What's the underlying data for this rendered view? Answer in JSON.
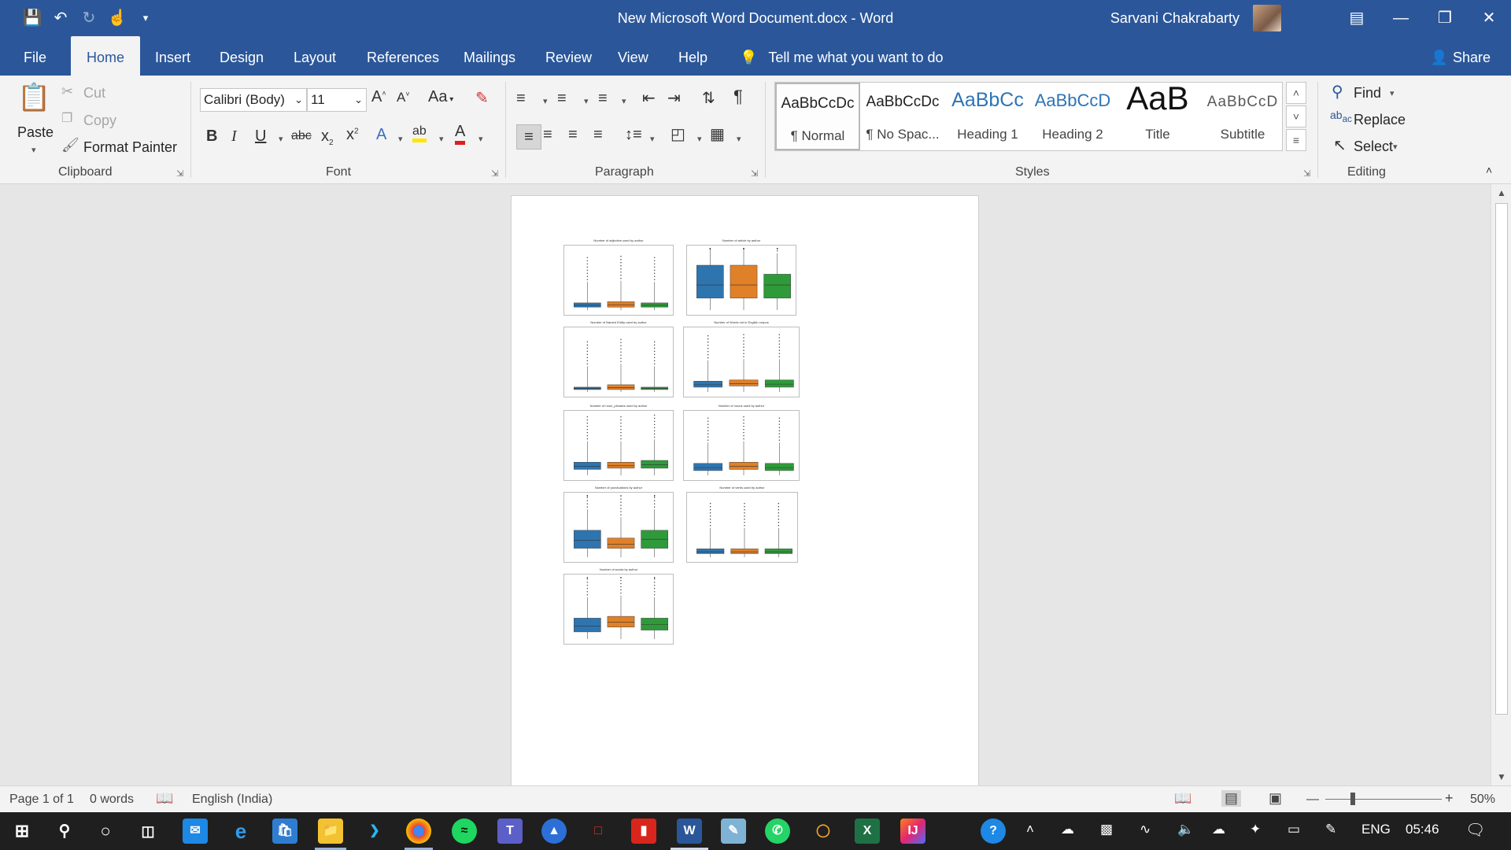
{
  "window": {
    "doc_title": "New Microsoft Word Document.docx  -  Word",
    "user_name": "Sarvani Chakrabarty"
  },
  "tabs": [
    "File",
    "Home",
    "Insert",
    "Design",
    "Layout",
    "References",
    "Mailings",
    "Review",
    "View",
    "Help"
  ],
  "tell_me": "Tell me what you want to do",
  "share_label": "Share",
  "clipboard": {
    "paste": "Paste",
    "cut": "Cut",
    "copy": "Copy",
    "format_painter": "Format Painter",
    "label": "Clipboard"
  },
  "font": {
    "name": "Calibri (Body)",
    "size": "11",
    "label": "Font",
    "change_case": "Aa"
  },
  "paragraph": {
    "label": "Paragraph"
  },
  "styles": {
    "label": "Styles",
    "items": [
      {
        "preview": "AaBbCcDc",
        "name": "¶ Normal"
      },
      {
        "preview": "AaBbCcDc",
        "name": "¶ No Spac..."
      },
      {
        "preview": "AaBbCc",
        "name": "Heading 1"
      },
      {
        "preview": "AaBbCcD",
        "name": "Heading 2"
      },
      {
        "preview": "AaB",
        "name": "Title"
      },
      {
        "preview": "AaBbCcD",
        "name": "Subtitle"
      }
    ]
  },
  "editing": {
    "label": "Editing",
    "find": "Find",
    "replace": "Replace",
    "select": "Select"
  },
  "document": {
    "plots": [
      {
        "title": "Number of adjective used by author"
      },
      {
        "title": "Number of article by author"
      },
      {
        "title": "Number of Named Entity used by author"
      },
      {
        "title": "Number of Words not in English corpus"
      },
      {
        "title": "Number of noun_phrases used by author"
      },
      {
        "title": "Number of nouns used by author"
      },
      {
        "title": "Number of punctuations by author"
      },
      {
        "title": "Number of verbs used by author"
      },
      {
        "title": "Number of words by author"
      }
    ],
    "colors": {
      "blue": "#2e75b0",
      "orange": "#e08028",
      "green": "#2f9a3a"
    }
  },
  "status": {
    "page": "Page 1 of 1",
    "words": "0 words",
    "language": "English (India)",
    "zoom": "50%"
  },
  "taskbar": {
    "lang": "ENG",
    "time": "05:46"
  }
}
